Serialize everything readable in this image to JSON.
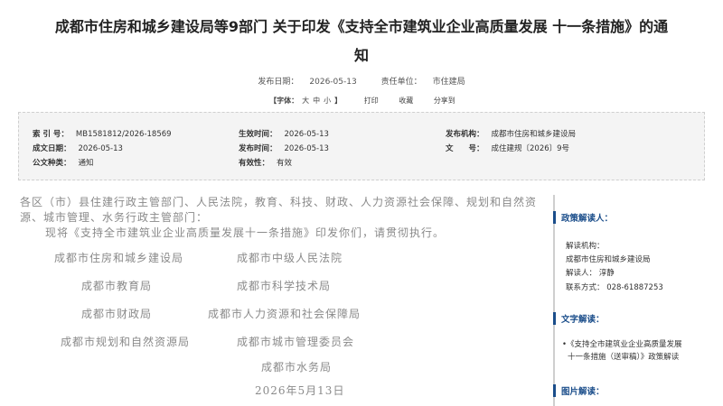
{
  "article": {
    "title_line1": "成都市住房和城乡建设局等9部门 关于印发《支持全市建筑业企业高质量发展 十一条措施》的通",
    "title_line2": "知",
    "pub_date_label": "发布日期：",
    "pub_date": "2026-05-13",
    "unit_label": "责任单位：",
    "unit": "市住建局"
  },
  "toolbar": {
    "font_label": "【字体：",
    "font_large": "大",
    "font_medium": "中",
    "font_small": "小",
    "font_end": "】",
    "print": "打印",
    "favorite": "收藏",
    "share": "分享到"
  },
  "meta": {
    "index_no_label": "索 引 号：",
    "index_no": "MB1581812/2026-18569",
    "effective_label": "生效时间：",
    "effective": "2026-05-13",
    "issuer_label": "发布机构：",
    "issuer": "成都市住房和城乡建设局",
    "created_label": "成文日期：",
    "created": "2026-05-13",
    "published_label": "发布时间：",
    "published": "2026-05-13",
    "docno_label": "文　　号：",
    "docno": "成住建规〔2026〕9号",
    "category_label": "公文种类：",
    "category": "通知",
    "validity_label": "有效性：",
    "validity": "有效"
  },
  "content": {
    "addressee": "各区（市）县住建行政主管部门、人民法院，教育、科技、财政、人力资源社会保障、规划和自然资源、城市管理、水务行政主管部门：",
    "body": "现将《支持全市建筑业企业高质量发展十一条措施》印发你们，请贯彻执行。",
    "orgs": [
      "成都市住房和城乡建设局",
      "成都市中级人民法院",
      "成都市教育局",
      "成都市科学技术局",
      "成都市财政局",
      "成都市人力资源和社会保障局",
      "成都市规划和自然资源局",
      "成都市城市管理委员会",
      "成都市水务局"
    ],
    "date": "2026年5月13日"
  },
  "sidebar": {
    "interpreter_header": "政策解读人：",
    "agency_label": "解读机构：",
    "agency": "成都市住房和城乡建设局",
    "person_label": "解读人：",
    "person": "淳静",
    "contact_label": "联系方式：",
    "contact": "028-61887253",
    "text_header": "文字解读：",
    "text_link_line1": "•《支持全市建筑业企业高质量发展",
    "text_link_line2": "十一条措施（送审稿）》政策解读",
    "image_header": "图片解读："
  }
}
